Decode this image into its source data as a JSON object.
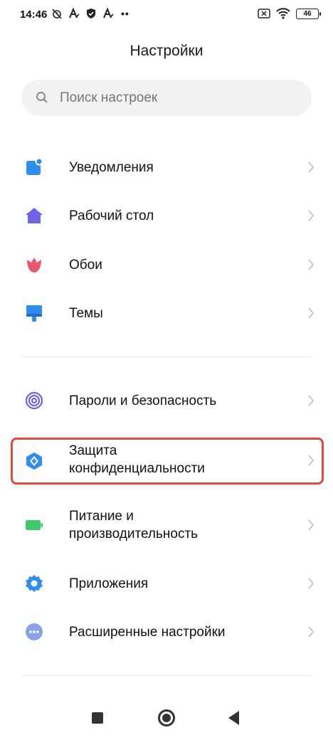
{
  "status_bar": {
    "time": "14:46",
    "battery": "46",
    "more": "••"
  },
  "header": {
    "title": "Настройки"
  },
  "search": {
    "placeholder": "Поиск настроек"
  },
  "items": [
    {
      "label": "Уведомления",
      "icon": "notification-icon",
      "color": "#2f8cf0"
    },
    {
      "label": "Рабочий стол",
      "icon": "home-icon",
      "color": "#6f63e6"
    },
    {
      "label": "Обои",
      "icon": "tulip-icon",
      "color": "#e8566e"
    },
    {
      "label": "Темы",
      "icon": "brush-icon",
      "color": "#2f8cf0"
    },
    {
      "label": "Пароли и безопасность",
      "icon": "fingerprint-icon",
      "color": "#6f63e6"
    },
    {
      "label": "Защита\nконфиденциальности",
      "icon": "privacy-shield-icon",
      "color": "#2f8cf0"
    },
    {
      "label": "Питание и\nпроизводительность",
      "icon": "battery-icon",
      "color": "#3ec96b"
    },
    {
      "label": "Приложения",
      "icon": "gear-icon",
      "color": "#2f8cf0"
    },
    {
      "label": "Расширенные настройки",
      "icon": "more-dots-icon",
      "color": "#8aa0e8"
    }
  ],
  "highlight_color": "#e04a3a"
}
